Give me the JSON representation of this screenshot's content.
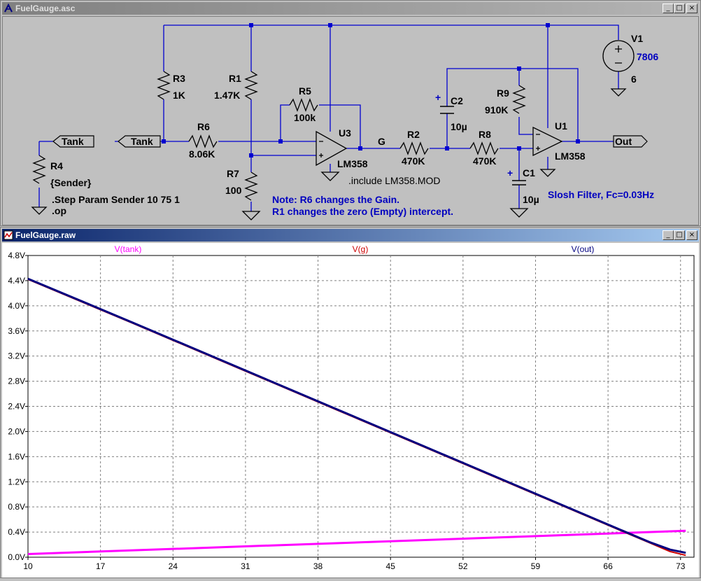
{
  "schematic_window": {
    "title": "FuelGauge.asc",
    "buttons": {
      "minimize": "_",
      "maximize": "□",
      "close": "×"
    },
    "components": {
      "r3": {
        "name": "R3",
        "value": "1K"
      },
      "r1": {
        "name": "R1",
        "value": "1.47K"
      },
      "r5": {
        "name": "R5",
        "value": "100k"
      },
      "r6": {
        "name": "R6",
        "value": "8.06K"
      },
      "r7": {
        "name": "R7",
        "value": "100"
      },
      "r4": {
        "name": "R4",
        "value": "{Sender}"
      },
      "u3": {
        "name": "U3",
        "value": "LM358"
      },
      "r2": {
        "name": "R2",
        "value": "470K"
      },
      "c2": {
        "name": "C2",
        "value": "10µ"
      },
      "r8": {
        "name": "R8",
        "value": "470K"
      },
      "c1": {
        "name": "C1",
        "value": "10µ"
      },
      "r9": {
        "name": "R9",
        "value": "910K"
      },
      "u1": {
        "name": "U1",
        "value": "LM358"
      },
      "v1": {
        "name": "V1",
        "value": "7806",
        "param": "6"
      }
    },
    "labels": {
      "tank_left": "Tank",
      "tank_mid": "Tank",
      "net_g": "G",
      "out": "Out",
      "step_directive": ".Step Param Sender 10 75 1",
      "op_directive": ".op",
      "include_directive": ".include LM358.MOD",
      "note_line1": "Note: R6 changes the Gain.",
      "note_line2": "R1 changes the zero (Empty)  intercept.",
      "slosh": "Slosh Filter, Fc=0.03Hz",
      "plus": "+"
    },
    "colors": {
      "wire": "#0000d0",
      "text": "#000000",
      "comment": "#0000c0",
      "body": "#000000"
    }
  },
  "plot_window": {
    "title": "FuelGauge.raw",
    "buttons": {
      "minimize": "_",
      "maximize": "□",
      "close": "×"
    }
  },
  "chart_data": {
    "type": "line",
    "series": [
      {
        "name": "V(tank)",
        "color": "#ff00ff",
        "x": [
          10,
          73.5
        ],
        "y": [
          0.05,
          0.42
        ]
      },
      {
        "name": "V(g)",
        "color": "#cc0000",
        "x": [
          10,
          20,
          30,
          40,
          50,
          60,
          68,
          70,
          72,
          73.5
        ],
        "y": [
          4.42,
          3.73,
          3.03,
          2.33,
          1.63,
          0.93,
          0.37,
          0.23,
          0.09,
          0.03
        ]
      },
      {
        "name": "V(out)",
        "color": "#000080",
        "x": [
          10,
          20,
          30,
          40,
          50,
          60,
          68,
          70,
          72,
          73.5
        ],
        "y": [
          4.43,
          3.74,
          3.04,
          2.34,
          1.64,
          0.94,
          0.38,
          0.24,
          0.12,
          0.07
        ]
      }
    ],
    "xlim": [
      10,
      74.3
    ],
    "ylim": [
      0.0,
      4.8
    ],
    "x_ticks": [
      "10",
      "17",
      "24",
      "31",
      "38",
      "45",
      "52",
      "59",
      "66",
      "73"
    ],
    "x_tick_values": [
      10,
      17,
      24,
      31,
      38,
      45,
      52,
      59,
      66,
      73
    ],
    "y_ticks": [
      "0.0V",
      "0.4V",
      "0.8V",
      "1.2V",
      "1.6V",
      "2.0V",
      "2.4V",
      "2.8V",
      "3.2V",
      "3.6V",
      "4.0V",
      "4.4V",
      "4.8V"
    ],
    "y_tick_values": [
      0.0,
      0.4,
      0.8,
      1.2,
      1.6,
      2.0,
      2.4,
      2.8,
      3.2,
      3.6,
      4.0,
      4.4,
      4.8
    ],
    "grid": true,
    "legend": "top"
  }
}
